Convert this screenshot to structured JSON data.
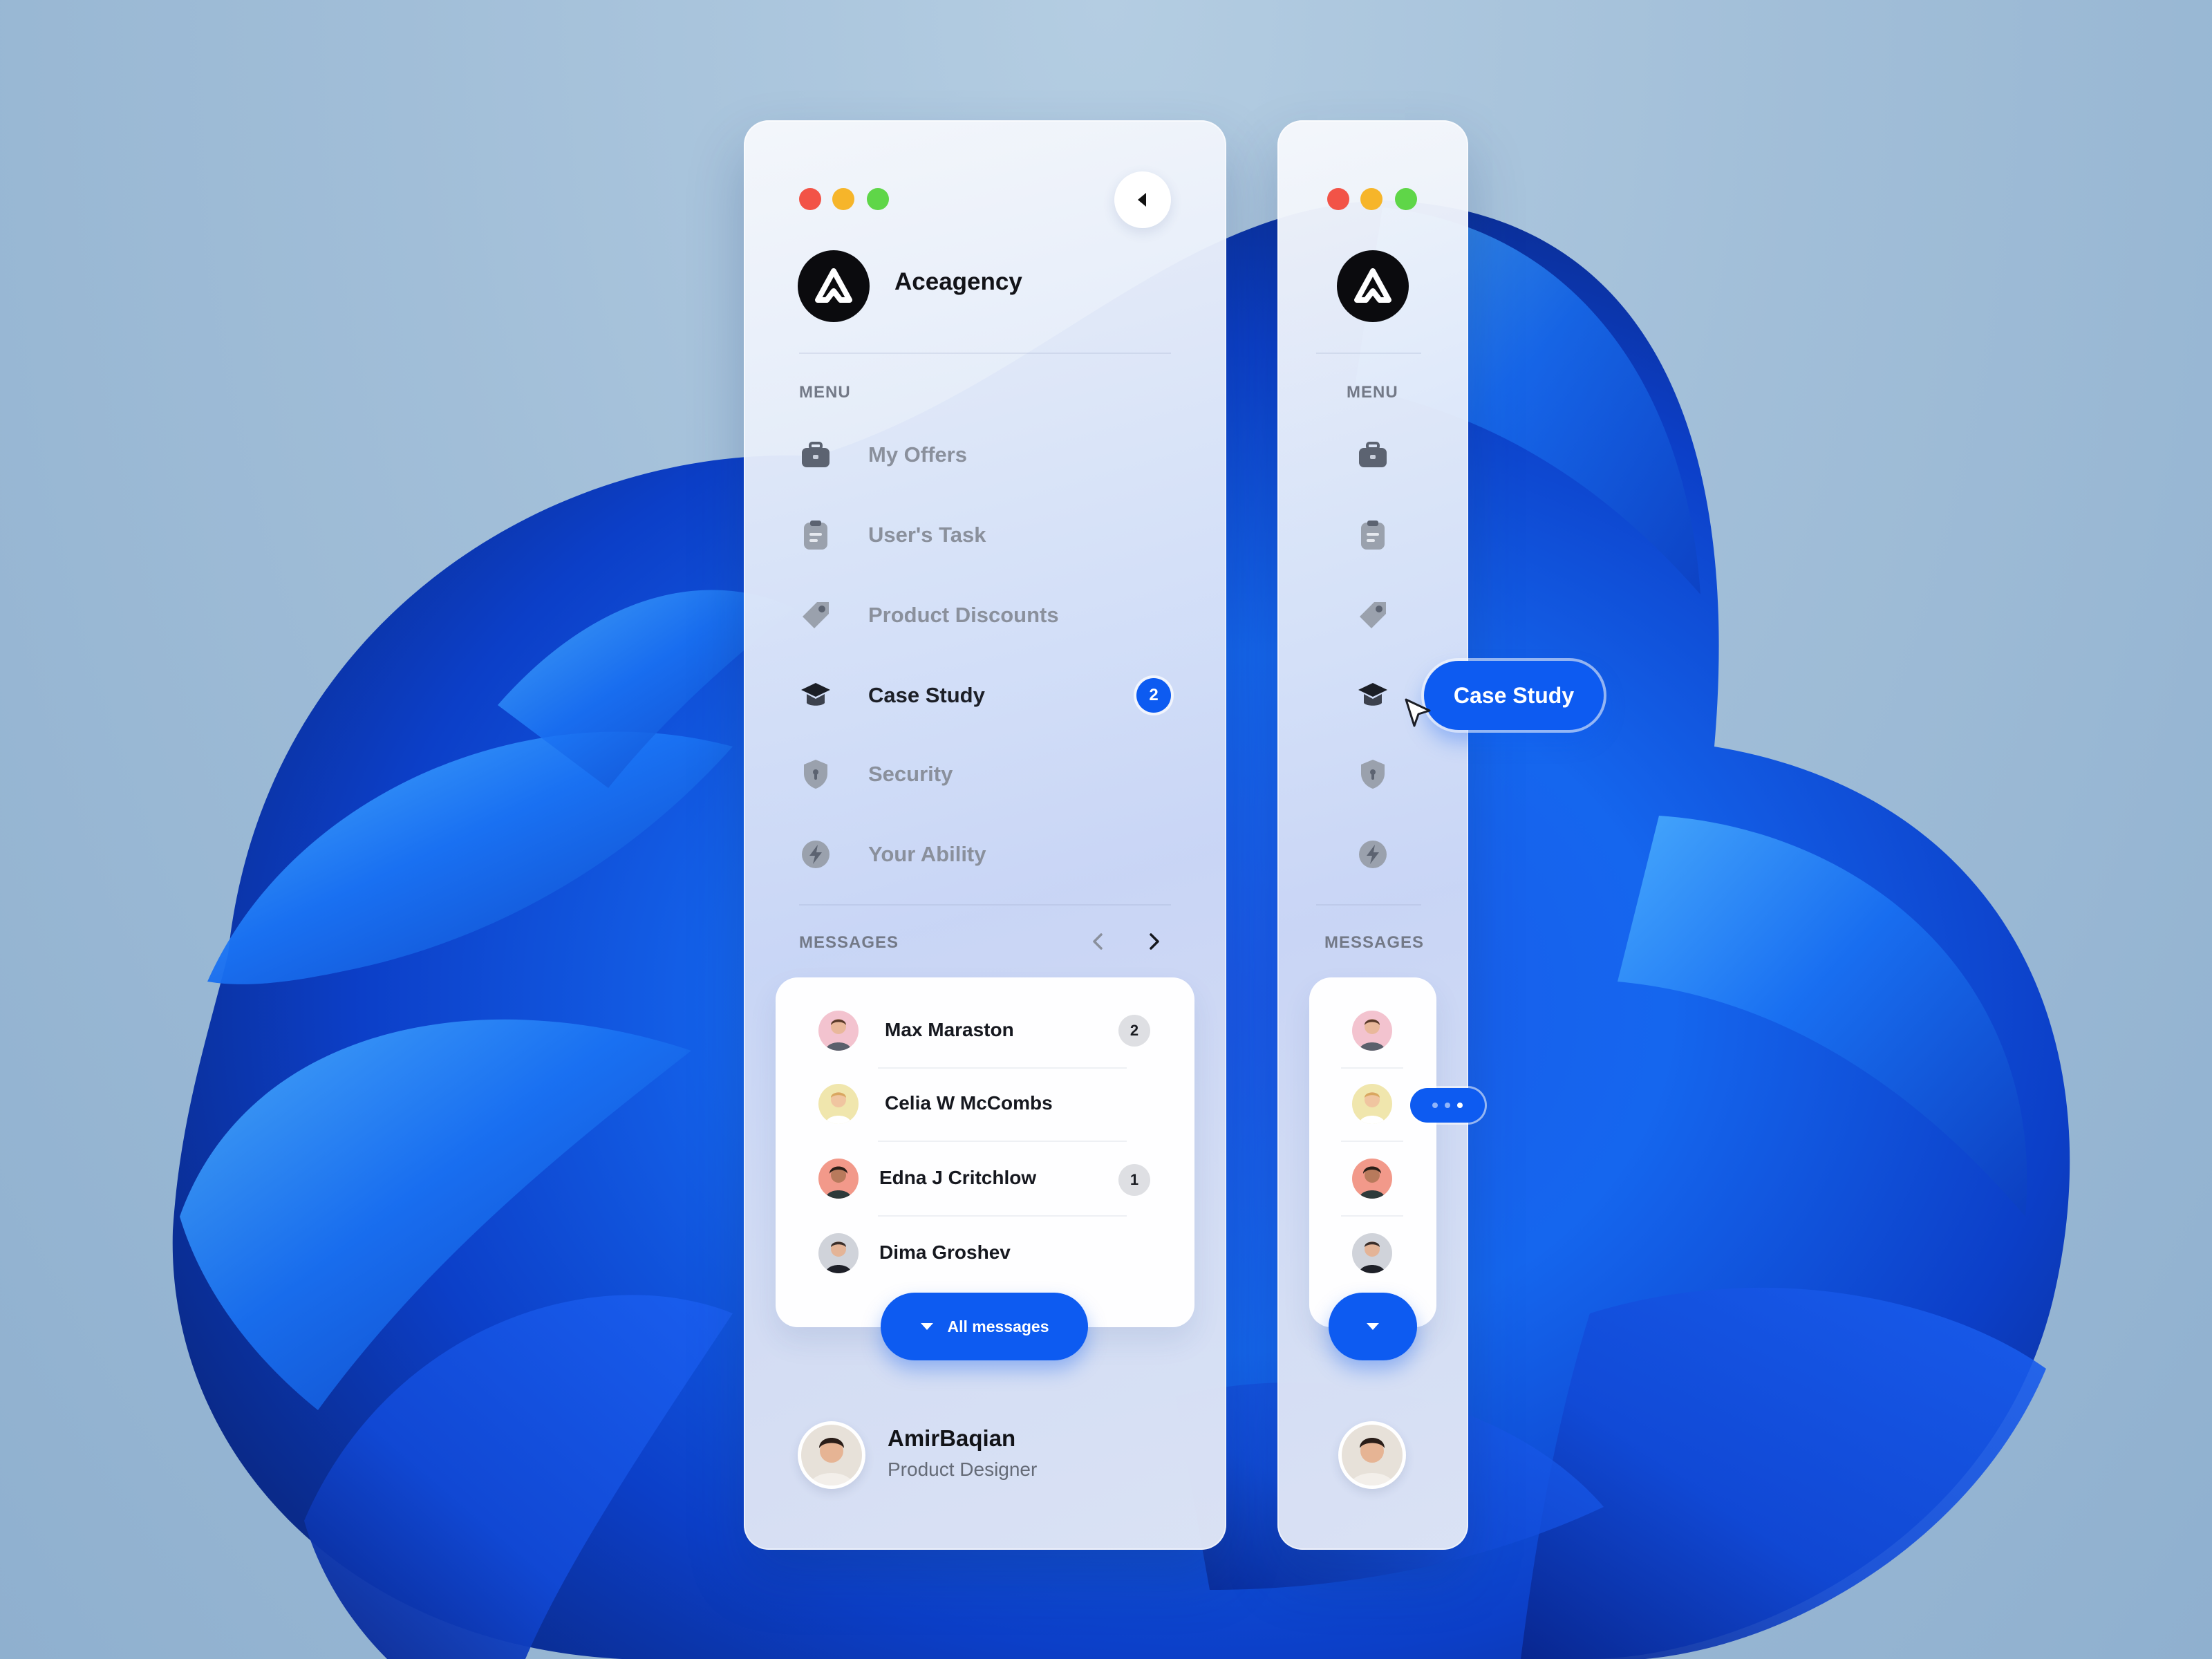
{
  "brand": {
    "name": "Aceagency"
  },
  "menu": {
    "label": "MENU",
    "items": [
      {
        "id": "my-offers",
        "label": "My Offers",
        "icon": "briefcase-icon"
      },
      {
        "id": "users-task",
        "label": "User's Task",
        "icon": "clipboard-icon"
      },
      {
        "id": "product-discounts",
        "label": "Product Discounts",
        "icon": "tag-icon"
      },
      {
        "id": "case-study",
        "label": "Case Study",
        "icon": "graduation-cap-icon",
        "active": true,
        "badge": "2"
      },
      {
        "id": "security",
        "label": "Security",
        "icon": "shield-icon"
      },
      {
        "id": "your-ability",
        "label": "Your Ability",
        "icon": "lightning-icon"
      }
    ]
  },
  "messages": {
    "label": "MESSAGES",
    "items": [
      {
        "name": "Max Maraston",
        "badge": "2",
        "avatar_bg": "#f3c3cf"
      },
      {
        "name": "Celia W McCombs",
        "avatar_bg": "#f0e6ad"
      },
      {
        "name": "Edna J Critchlow",
        "badge": "1",
        "avatar_bg": "#f2998a"
      },
      {
        "name": "Dima Groshev",
        "avatar_bg": "#d0d3da"
      }
    ],
    "all_button_label": "All messages"
  },
  "profile": {
    "name": "AmirBaqian",
    "role": "Product Designer"
  },
  "tooltip": {
    "label": "Case Study"
  },
  "colors": {
    "accent": "#0d5bf1",
    "window_close": "#f25347",
    "window_minimize": "#f6b52a",
    "window_zoom": "#5fd648"
  }
}
